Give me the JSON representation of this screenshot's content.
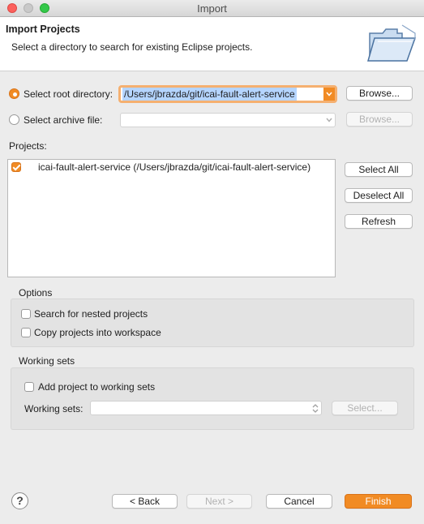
{
  "window": {
    "title": "Import"
  },
  "header": {
    "title": "Import Projects",
    "description": "Select a directory to search for existing Eclipse projects."
  },
  "source": {
    "root_dir_label": "Select root directory:",
    "root_dir_value": "/Users/jbrazda/git/icai-fault-alert-service",
    "archive_label": "Select archive file:",
    "archive_value": "",
    "browse_label": "Browse..."
  },
  "projects": {
    "label": "Projects:",
    "items": [
      {
        "label": "icai-fault-alert-service (/Users/jbrazda/git/icai-fault-alert-service)",
        "checked": true
      }
    ],
    "select_all": "Select All",
    "deselect_all": "Deselect All",
    "refresh": "Refresh"
  },
  "options": {
    "title": "Options",
    "nested": "Search for nested projects",
    "copy": "Copy projects into workspace"
  },
  "working_sets": {
    "title": "Working sets",
    "add_label": "Add project to working sets",
    "sets_label": "Working sets:",
    "sets_value": "",
    "select_label": "Select..."
  },
  "footer": {
    "help": "?",
    "back": "< Back",
    "next": "Next >",
    "cancel": "Cancel",
    "finish": "Finish"
  },
  "colors": {
    "accent": "#f18b24",
    "selection": "#b5d5ff"
  }
}
